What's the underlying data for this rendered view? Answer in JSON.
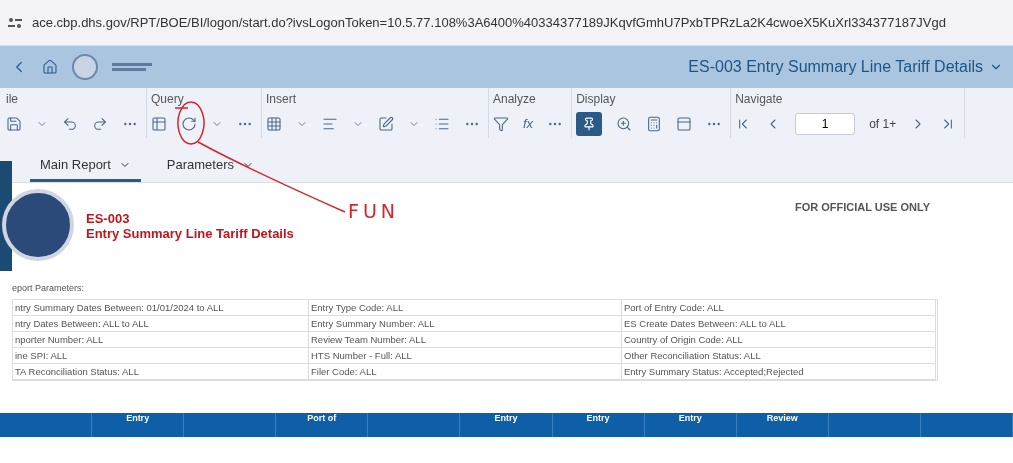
{
  "address_bar": {
    "url": "ace.cbp.dhs.gov/RPT/BOE/BI/logon/start.do?ivsLogonToken=10.5.77.108%3A6400%40334377189JKqvfGmhU7PxbTPRzLa2K4cwoeX5KuXrl334377187JVgd"
  },
  "header": {
    "title": "ES-003 Entry Summary Line Tariff Details"
  },
  "toolbar": {
    "groups": [
      {
        "label": "ile"
      },
      {
        "label": "Query"
      },
      {
        "label": "Insert"
      },
      {
        "label": "Analyze"
      },
      {
        "label": "Display",
        "pin_on": true
      },
      {
        "label": "Navigate"
      }
    ],
    "formula_label": "fx",
    "page_field": {
      "value": "1"
    },
    "page_count": "of 1+"
  },
  "tabs": [
    {
      "label": "Main Report",
      "selected": true
    },
    {
      "label": "Parameters",
      "selected": false
    }
  ],
  "annotation": {
    "text": "FUN"
  },
  "report": {
    "code": "ES-003",
    "title": "Entry Summary Line Tariff Details",
    "notice": "FOR OFFICIAL USE ONLY",
    "params_label": "eport Parameters:",
    "params": [
      [
        "ntry Summary Dates Between:  01/01/2024 to ALL",
        "Entry Type Code: ALL",
        "Port of Entry Code: ALL"
      ],
      [
        "ntry Dates Between:  ALL to ALL",
        "Entry Summary Number: ALL",
        "ES Create Dates Between:  ALL to ALL"
      ],
      [
        "nporter Number: ALL",
        "Review Team Number: ALL",
        "Country of Origin Code: ALL"
      ],
      [
        "ine SPI: ALL",
        "HTS Number - Full: ALL",
        "Other Reconciliation Status: ALL"
      ],
      [
        "TA Reconciliation Status: ALL",
        "Filer Code: ALL",
        "Entry Summary Status: Accepted;Rejected"
      ]
    ],
    "columns": [
      "",
      "Entry",
      "",
      "Port of",
      "",
      "Entry",
      "Entry",
      "Entry",
      "Review",
      "",
      ""
    ]
  }
}
